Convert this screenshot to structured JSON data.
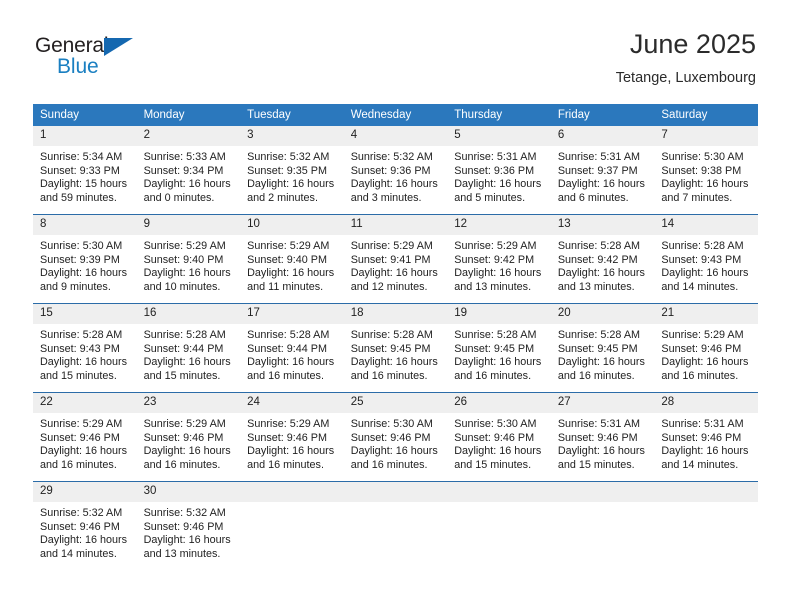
{
  "brand": {
    "name_top": "General",
    "name_bottom": "Blue",
    "accent_color": "#1568b0",
    "text_color": "#231f20"
  },
  "header": {
    "title": "June 2025",
    "subtitle": "Tetange, Luxembourg"
  },
  "theme": {
    "header_row_bg": "#2b78bd",
    "week_divider": "#2b6ca8",
    "daynum_bg": "#efefef"
  },
  "columns": [
    "Sunday",
    "Monday",
    "Tuesday",
    "Wednesday",
    "Thursday",
    "Friday",
    "Saturday"
  ],
  "weeks": [
    [
      {
        "day": "1",
        "sunrise": "Sunrise: 5:34 AM",
        "sunset": "Sunset: 9:33 PM",
        "daylight_1": "Daylight: 15 hours",
        "daylight_2": "and 59 minutes."
      },
      {
        "day": "2",
        "sunrise": "Sunrise: 5:33 AM",
        "sunset": "Sunset: 9:34 PM",
        "daylight_1": "Daylight: 16 hours",
        "daylight_2": "and 0 minutes."
      },
      {
        "day": "3",
        "sunrise": "Sunrise: 5:32 AM",
        "sunset": "Sunset: 9:35 PM",
        "daylight_1": "Daylight: 16 hours",
        "daylight_2": "and 2 minutes."
      },
      {
        "day": "4",
        "sunrise": "Sunrise: 5:32 AM",
        "sunset": "Sunset: 9:36 PM",
        "daylight_1": "Daylight: 16 hours",
        "daylight_2": "and 3 minutes."
      },
      {
        "day": "5",
        "sunrise": "Sunrise: 5:31 AM",
        "sunset": "Sunset: 9:36 PM",
        "daylight_1": "Daylight: 16 hours",
        "daylight_2": "and 5 minutes."
      },
      {
        "day": "6",
        "sunrise": "Sunrise: 5:31 AM",
        "sunset": "Sunset: 9:37 PM",
        "daylight_1": "Daylight: 16 hours",
        "daylight_2": "and 6 minutes."
      },
      {
        "day": "7",
        "sunrise": "Sunrise: 5:30 AM",
        "sunset": "Sunset: 9:38 PM",
        "daylight_1": "Daylight: 16 hours",
        "daylight_2": "and 7 minutes."
      }
    ],
    [
      {
        "day": "8",
        "sunrise": "Sunrise: 5:30 AM",
        "sunset": "Sunset: 9:39 PM",
        "daylight_1": "Daylight: 16 hours",
        "daylight_2": "and 9 minutes."
      },
      {
        "day": "9",
        "sunrise": "Sunrise: 5:29 AM",
        "sunset": "Sunset: 9:40 PM",
        "daylight_1": "Daylight: 16 hours",
        "daylight_2": "and 10 minutes."
      },
      {
        "day": "10",
        "sunrise": "Sunrise: 5:29 AM",
        "sunset": "Sunset: 9:40 PM",
        "daylight_1": "Daylight: 16 hours",
        "daylight_2": "and 11 minutes."
      },
      {
        "day": "11",
        "sunrise": "Sunrise: 5:29 AM",
        "sunset": "Sunset: 9:41 PM",
        "daylight_1": "Daylight: 16 hours",
        "daylight_2": "and 12 minutes."
      },
      {
        "day": "12",
        "sunrise": "Sunrise: 5:29 AM",
        "sunset": "Sunset: 9:42 PM",
        "daylight_1": "Daylight: 16 hours",
        "daylight_2": "and 13 minutes."
      },
      {
        "day": "13",
        "sunrise": "Sunrise: 5:28 AM",
        "sunset": "Sunset: 9:42 PM",
        "daylight_1": "Daylight: 16 hours",
        "daylight_2": "and 13 minutes."
      },
      {
        "day": "14",
        "sunrise": "Sunrise: 5:28 AM",
        "sunset": "Sunset: 9:43 PM",
        "daylight_1": "Daylight: 16 hours",
        "daylight_2": "and 14 minutes."
      }
    ],
    [
      {
        "day": "15",
        "sunrise": "Sunrise: 5:28 AM",
        "sunset": "Sunset: 9:43 PM",
        "daylight_1": "Daylight: 16 hours",
        "daylight_2": "and 15 minutes."
      },
      {
        "day": "16",
        "sunrise": "Sunrise: 5:28 AM",
        "sunset": "Sunset: 9:44 PM",
        "daylight_1": "Daylight: 16 hours",
        "daylight_2": "and 15 minutes."
      },
      {
        "day": "17",
        "sunrise": "Sunrise: 5:28 AM",
        "sunset": "Sunset: 9:44 PM",
        "daylight_1": "Daylight: 16 hours",
        "daylight_2": "and 16 minutes."
      },
      {
        "day": "18",
        "sunrise": "Sunrise: 5:28 AM",
        "sunset": "Sunset: 9:45 PM",
        "daylight_1": "Daylight: 16 hours",
        "daylight_2": "and 16 minutes."
      },
      {
        "day": "19",
        "sunrise": "Sunrise: 5:28 AM",
        "sunset": "Sunset: 9:45 PM",
        "daylight_1": "Daylight: 16 hours",
        "daylight_2": "and 16 minutes."
      },
      {
        "day": "20",
        "sunrise": "Sunrise: 5:28 AM",
        "sunset": "Sunset: 9:45 PM",
        "daylight_1": "Daylight: 16 hours",
        "daylight_2": "and 16 minutes."
      },
      {
        "day": "21",
        "sunrise": "Sunrise: 5:29 AM",
        "sunset": "Sunset: 9:46 PM",
        "daylight_1": "Daylight: 16 hours",
        "daylight_2": "and 16 minutes."
      }
    ],
    [
      {
        "day": "22",
        "sunrise": "Sunrise: 5:29 AM",
        "sunset": "Sunset: 9:46 PM",
        "daylight_1": "Daylight: 16 hours",
        "daylight_2": "and 16 minutes."
      },
      {
        "day": "23",
        "sunrise": "Sunrise: 5:29 AM",
        "sunset": "Sunset: 9:46 PM",
        "daylight_1": "Daylight: 16 hours",
        "daylight_2": "and 16 minutes."
      },
      {
        "day": "24",
        "sunrise": "Sunrise: 5:29 AM",
        "sunset": "Sunset: 9:46 PM",
        "daylight_1": "Daylight: 16 hours",
        "daylight_2": "and 16 minutes."
      },
      {
        "day": "25",
        "sunrise": "Sunrise: 5:30 AM",
        "sunset": "Sunset: 9:46 PM",
        "daylight_1": "Daylight: 16 hours",
        "daylight_2": "and 16 minutes."
      },
      {
        "day": "26",
        "sunrise": "Sunrise: 5:30 AM",
        "sunset": "Sunset: 9:46 PM",
        "daylight_1": "Daylight: 16 hours",
        "daylight_2": "and 15 minutes."
      },
      {
        "day": "27",
        "sunrise": "Sunrise: 5:31 AM",
        "sunset": "Sunset: 9:46 PM",
        "daylight_1": "Daylight: 16 hours",
        "daylight_2": "and 15 minutes."
      },
      {
        "day": "28",
        "sunrise": "Sunrise: 5:31 AM",
        "sunset": "Sunset: 9:46 PM",
        "daylight_1": "Daylight: 16 hours",
        "daylight_2": "and 14 minutes."
      }
    ],
    [
      {
        "day": "29",
        "sunrise": "Sunrise: 5:32 AM",
        "sunset": "Sunset: 9:46 PM",
        "daylight_1": "Daylight: 16 hours",
        "daylight_2": "and 14 minutes."
      },
      {
        "day": "30",
        "sunrise": "Sunrise: 5:32 AM",
        "sunset": "Sunset: 9:46 PM",
        "daylight_1": "Daylight: 16 hours",
        "daylight_2": "and 13 minutes."
      },
      null,
      null,
      null,
      null,
      null
    ]
  ]
}
